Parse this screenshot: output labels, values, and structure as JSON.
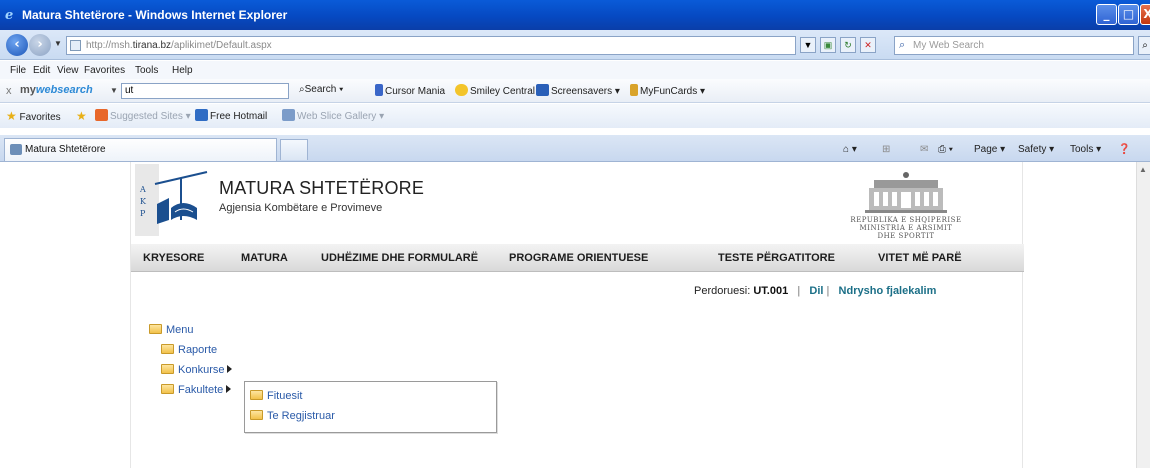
{
  "window": {
    "title": "Matura Shtetërore - Windows Internet Explorer",
    "minimize": "_",
    "maximize": "□",
    "close": "X"
  },
  "address": {
    "url_prefix": "http://msh.",
    "url_host": "tirana.bz",
    "url_path": "/aplikimet/Default.aspx",
    "search_placeholder": "My Web Search"
  },
  "menubar": [
    "File",
    "Edit",
    "View",
    "Favorites",
    "Tools",
    "Help"
  ],
  "mywebsearch": {
    "brand_prefix": "my",
    "brand_suffix": "websearch",
    "query": "ut",
    "items": [
      "Search",
      "Cursor Mania",
      "Smiley Central",
      "Screensavers",
      "MyFunCards"
    ]
  },
  "favorites_bar": {
    "favorites": "Favorites",
    "suggested": "Suggested Sites",
    "hotmail": "Free Hotmail",
    "webslice": "Web Slice Gallery"
  },
  "tab": {
    "title": "Matura Shtetërore"
  },
  "commandbar": [
    "Page",
    "Safety",
    "Tools"
  ],
  "site": {
    "title": "MATURA SHTETËRORE",
    "subtitle": "Agjensia Kombëtare e Provimeve",
    "logo_letters": [
      "A",
      "K",
      "P"
    ],
    "ministry_lines": [
      "REPUBLIKA E SHQIPERISE",
      "MINISTRIA E ARSIMIT",
      "DHE SPORTIT"
    ],
    "nav": [
      "KRYESORE",
      "MATURA",
      "UDHËZIME DHE FORMULARË",
      "PROGRAME ORIENTUESE",
      "TESTE PËRGATITORE",
      "VITET MË PARË"
    ]
  },
  "user": {
    "label": "Perdoruesi:",
    "id": "UT.001",
    "sep1": "|",
    "dil": "Dil",
    "sep2": "|",
    "change_password": "Ndrysho fjalekalim"
  },
  "menu": {
    "root": "Menu",
    "items": [
      "Raporte",
      "Konkurse",
      "Fakultete"
    ],
    "submenu": [
      "Fituesit",
      "Te Regjistruar"
    ]
  }
}
